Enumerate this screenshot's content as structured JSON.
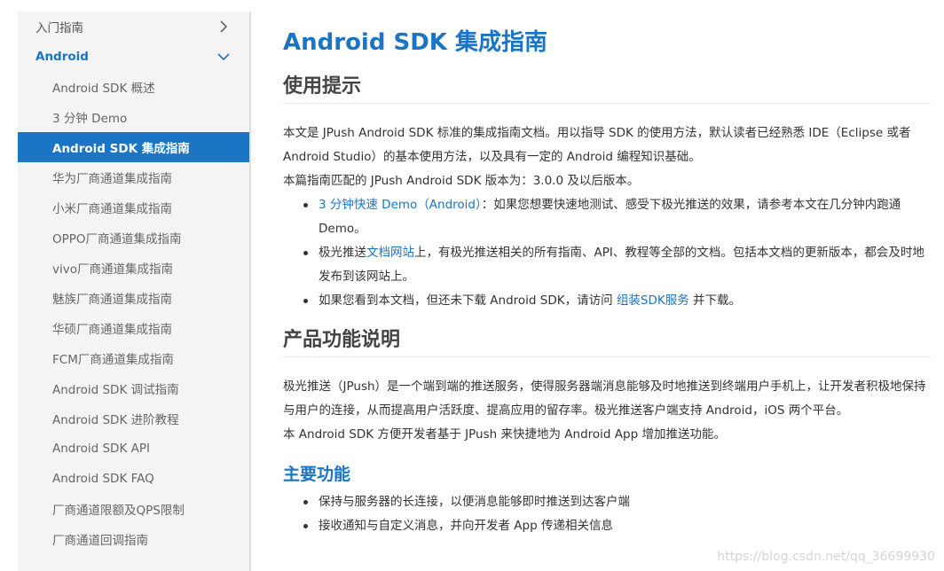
{
  "sidebar": {
    "top_item": "入门指南",
    "section": "Android",
    "items": [
      "Android SDK 概述",
      "3 分钟 Demo",
      "Android SDK 集成指南",
      "华为厂商通道集成指南",
      "小米厂商通道集成指南",
      "OPPO厂商通道集成指南",
      "vivo厂商通道集成指南",
      "魅族厂商通道集成指南",
      "华硕厂商通道集成指南",
      "FCM厂商通道集成指南",
      "Android SDK 调试指南",
      "Android SDK 进阶教程",
      "Android SDK API",
      "Android SDK FAQ",
      "厂商通道限额及QPS限制",
      "厂商通道回调指南"
    ]
  },
  "content": {
    "title": "Android SDK 集成指南",
    "usage_heading": "使用提示",
    "usage_p1": "本文是 JPush Android SDK 标准的集成指南文档。用以指导 SDK 的使用方法，默认读者已经熟悉 IDE（Eclipse 或者 Android Studio）的基本使用方法，以及具有一定的 Android 编程知识基础。",
    "usage_p2": "本篇指南匹配的 JPush Android SDK 版本为：3.0.0 及以后版本。",
    "bullet1_link": "3 分钟快速 Demo（Android）",
    "bullet1_text": "：如果您想要快速地测试、感受下极光推送的效果，请参考本文在几分钟内跑通 Demo。",
    "bullet2_pre": "极光推送",
    "bullet2_link": "文档网站",
    "bullet2_text": "上，有极光推送相关的所有指南、API、教程等全部的文档。包括本文档的更新版本，都会及时地发布到该网站上。",
    "bullet3_pre": "如果您看到本文档，但还未下载 Android SDK，请访问 ",
    "bullet3_link": "组装SDK服务",
    "bullet3_text": " 并下载。",
    "product_heading": "产品功能说明",
    "product_p1": "极光推送（JPush）是一个端到端的推送服务，使得服务器端消息能够及时地推送到终端用户手机上，让开发者积极地保持与用户的连接，从而提高用户活跃度、提高应用的留存率。极光推送客户端支持 Android，iOS 两个平台。",
    "product_p2": "本 Android SDK 方便开发者基于 JPush 来快捷地为 Android App 增加推送功能。",
    "features_heading": "主要功能",
    "features": [
      "保持与服务器的长连接，以便消息能够即时推送到达客户端",
      "接收通知与自定义消息，并向开发者 App 传递相关信息"
    ]
  },
  "watermark": "https://blog.csdn.net/qq_36699930",
  "colors": {
    "accent": "#1b75c4",
    "sidebar_bg": "#f4f4f4"
  }
}
